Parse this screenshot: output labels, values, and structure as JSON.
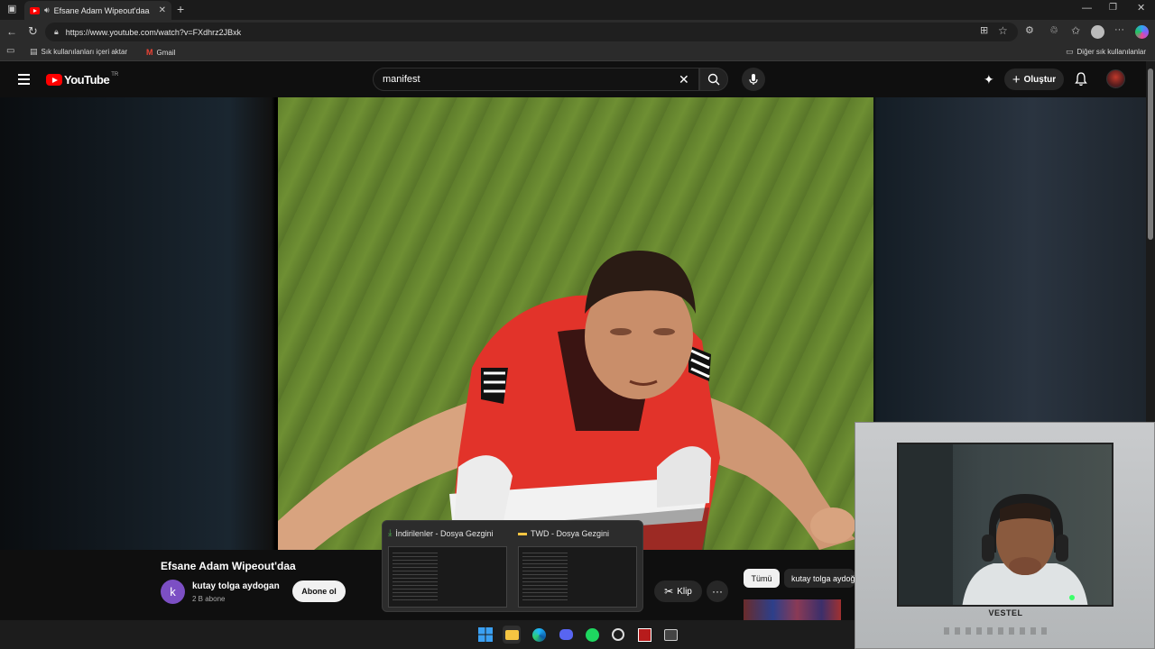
{
  "browser": {
    "tab_title": "Efsane Adam Wipeout'daa",
    "url": "https://www.youtube.com/watch?v=FXdhrz2JBxk",
    "bookmarks": {
      "import_label": "Sık kullanılanları içeri aktar",
      "gmail_label": "Gmail",
      "other_label": "Diğer sık kullanılanlar"
    }
  },
  "youtube": {
    "logo_text": "YouTube",
    "region": "TR",
    "search_value": "manifest",
    "create_label": "Oluştur"
  },
  "video": {
    "title": "Efsane Adam Wipeout'daa",
    "channel_initial": "k",
    "channel_name": "kutay tolga aydogan",
    "subscribers": "2 B abone",
    "subscribe_label": "Abone ol",
    "clip_label": "Klip",
    "more_label": "···"
  },
  "chips": {
    "all_label": "Tümü",
    "channel_label": "kutay tolga aydoğ"
  },
  "previews": [
    {
      "title": "İndirilenler - Dosya Gezgini",
      "icon": "download-icon"
    },
    {
      "title": "TWD - Dosya Gezgini",
      "icon": "folder-icon"
    }
  ],
  "webcam": {
    "brand": "VESTEL"
  },
  "colors": {
    "yt_red": "#ff0000",
    "yt_bg": "#0f0f0f",
    "avatar_purple": "#7c4fc4"
  }
}
